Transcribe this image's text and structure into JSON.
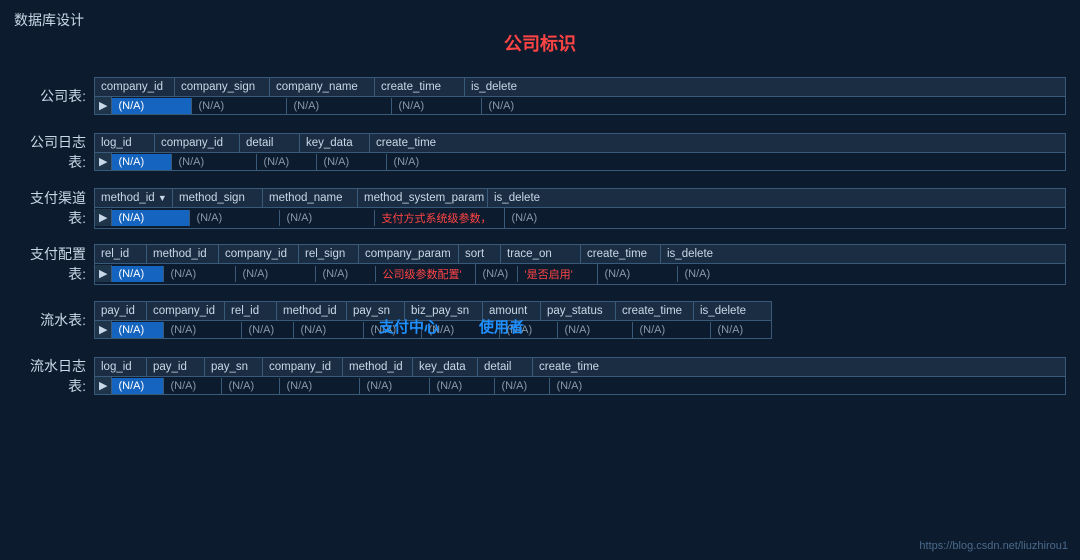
{
  "page": {
    "title": "数据库设计",
    "center_label": "公司标识",
    "watermark": "https://blog.csdn.net/liuzhirou1"
  },
  "tables": [
    {
      "label": "公司表:",
      "columns": [
        "company_id",
        "company_sign",
        "company_name",
        "create_time",
        "is_delete"
      ],
      "body": [
        "(N/A)",
        "(N/A)",
        "(N/A)",
        "(N/A)",
        "(N/A)"
      ],
      "highlighted_col": 0,
      "widths": [
        "80px",
        "95px",
        "105px",
        "90px",
        "70px"
      ]
    },
    {
      "label": "公司日志表:",
      "columns": [
        "log_id",
        "company_id",
        "detail",
        "key_data",
        "create_time"
      ],
      "body": [
        "(N/A)",
        "(N/A)",
        "(N/A)",
        "(N/A)",
        "(N/A)"
      ],
      "highlighted_col": 0,
      "widths": [
        "60px",
        "85px",
        "60px",
        "70px",
        "90px"
      ]
    },
    {
      "label": "支付渠道表:",
      "columns": [
        "method_id",
        "method_sign",
        "method_name",
        "method_system_param",
        "is_delete"
      ],
      "body": [
        "(N/A)",
        "(N/A)",
        "(N/A)",
        "支付方式系统级参数，",
        "(N/A)"
      ],
      "highlighted_col": 0,
      "has_sort_arrow": true,
      "red_col": 3,
      "widths": [
        "78px",
        "90px",
        "95px",
        "130px",
        "70px"
      ]
    },
    {
      "label": "支付配置表:",
      "columns": [
        "rel_id",
        "method_id",
        "company_id",
        "rel_sign",
        "company_param",
        "sort",
        "trace_on",
        "create_time",
        "is_delete"
      ],
      "body": [
        "(N/A)",
        "(N/A)",
        "(N/A)",
        "(N/A)",
        "公司级参数配置'",
        "(N/A)",
        "'是否启用'",
        "(N/A)",
        "(N/A)"
      ],
      "highlighted_col": 0,
      "red_cols": [
        4,
        6
      ],
      "widths": [
        "52px",
        "72px",
        "80px",
        "60px",
        "100px",
        "42px",
        "80px",
        "80px",
        "60px"
      ]
    },
    {
      "label": "流水表:",
      "columns": [
        "pay_id",
        "company_id",
        "rel_id",
        "method_id",
        "pay_sn",
        "biz_pay_sn",
        "amount",
        "pay_status",
        "create_time",
        "is_delete"
      ],
      "body": [
        "(N/A)",
        "(N/A)",
        "(N/A)",
        "(N/A)",
        "(N/A)",
        "(N/A)",
        "(N/A)",
        "(N/A)",
        "(N/A)",
        "(N/A)"
      ],
      "highlighted_col": 0,
      "float_labels": [
        "支付中心",
        "使用者"
      ],
      "widths": [
        "52px",
        "78px",
        "52px",
        "70px",
        "58px",
        "78px",
        "58px",
        "75px",
        "78px",
        "60px"
      ]
    },
    {
      "label": "流水日志表:",
      "columns": [
        "log_id",
        "pay_id",
        "pay_sn",
        "company_id",
        "method_id",
        "key_data",
        "detail",
        "create_time"
      ],
      "body": [
        "(N/A)",
        "(N/A)",
        "(N/A)",
        "(N/A)",
        "(N/A)",
        "(N/A)",
        "(N/A)",
        "(N/A)"
      ],
      "highlighted_col": 0,
      "widths": [
        "52px",
        "58px",
        "58px",
        "80px",
        "70px",
        "65px",
        "55px",
        "80px"
      ]
    }
  ]
}
